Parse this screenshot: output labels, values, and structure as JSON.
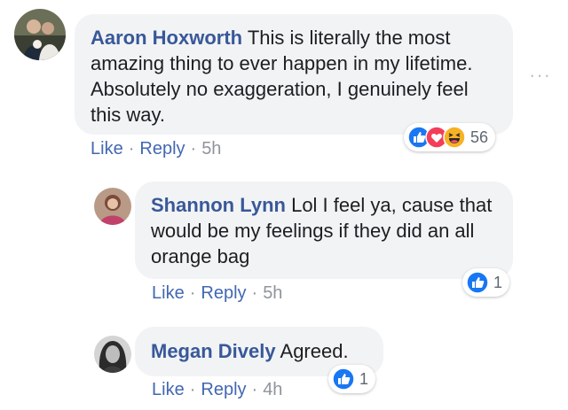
{
  "comments": [
    {
      "author": "Aaron Hoxworth",
      "text": "This is literally the most amazing thing to ever happen in my lifetime. Absolutely no exaggeration, I genuinely feel this way.",
      "like_label": "Like",
      "reply_label": "Reply",
      "time": "5h",
      "reaction_icons": [
        "like-icon",
        "love-icon",
        "haha-icon"
      ],
      "reaction_count": "56"
    },
    {
      "author": "Shannon Lynn",
      "text": "Lol I feel ya, cause that would be my feelings if they did an all orange bag",
      "like_label": "Like",
      "reply_label": "Reply",
      "time": "5h",
      "reaction_icons": [
        "like-icon"
      ],
      "reaction_count": "1"
    },
    {
      "author": "Megan Dively",
      "text": "Agreed.",
      "like_label": "Like",
      "reply_label": "Reply",
      "time": "4h",
      "reaction_icons": [
        "like-icon"
      ],
      "reaction_count": "1"
    }
  ],
  "more_options": "···",
  "separator": "·",
  "colors": {
    "author": "#385898",
    "link": "#4267b2",
    "bubble": "#f2f3f5",
    "like_blue": "#1877f2",
    "love_red": "#f33e58",
    "haha_yellow": "#f7b125"
  }
}
